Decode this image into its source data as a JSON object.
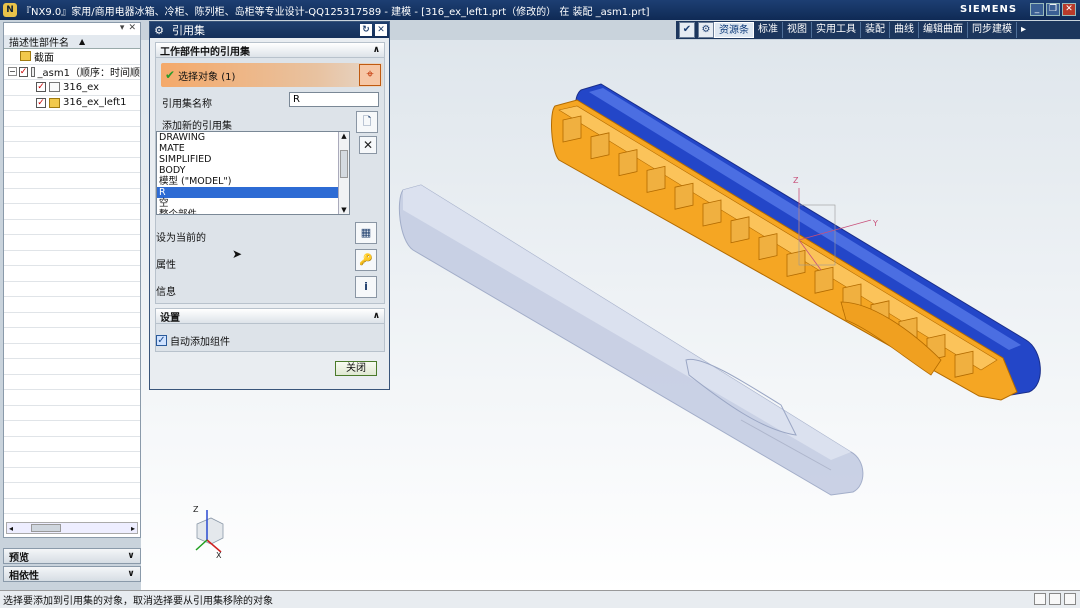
{
  "window": {
    "title": "『NX9.0』家用/商用电器冰箱、冷柜、陈列柜、岛柜等专业设计-QQ125317589 - 建模 - [316_ex_left1.prt（修改的） 在 装配 _asm1.prt]",
    "brand": "SIEMENS"
  },
  "toolbar": {
    "tabs": [
      "资源条",
      "标准",
      "视图",
      "实用工具",
      "装配",
      "曲线",
      "编辑曲面",
      "同步建模"
    ],
    "active_tab_index": 0
  },
  "navigator": {
    "column_header": "描述性部件名",
    "rows": [
      {
        "label": "截面"
      },
      {
        "label": "_asm1（顺序：时间顺"
      },
      {
        "label": "316_ex"
      },
      {
        "label": "316_ex_left1"
      }
    ],
    "preview_label": "预览",
    "dependency_label": "相依性"
  },
  "dialog": {
    "title": "引用集",
    "section_work_part": "工作部件中的引用集",
    "select_object": "选择对象 (1)",
    "ref_name_label": "引用集名称",
    "ref_name_value": "R",
    "add_new_label": "添加新的引用集",
    "list_items": [
      "DRAWING",
      "MATE",
      "SIMPLIFIED",
      "BODY",
      "模型 (\"MODEL\")",
      "R",
      "空",
      "整个部件"
    ],
    "selected_index": 5,
    "set_current_label": "设为当前的",
    "properties_label": "属性",
    "info_label": "信息",
    "settings_label": "设置",
    "auto_add_label": "自动添加组件",
    "auto_add_checked": true,
    "close_label": "关闭"
  },
  "status": {
    "message": "选择要添加到引用集的对象，取消选择要从引用集移除的对象"
  },
  "axis": {
    "x": "X",
    "y": "Y",
    "z": "Z"
  },
  "colors": {
    "orange_part": "#f5a623",
    "blue_part": "#2346c8",
    "ghost_part": "#c8d0e6",
    "title_bar": "#1d3f73"
  }
}
